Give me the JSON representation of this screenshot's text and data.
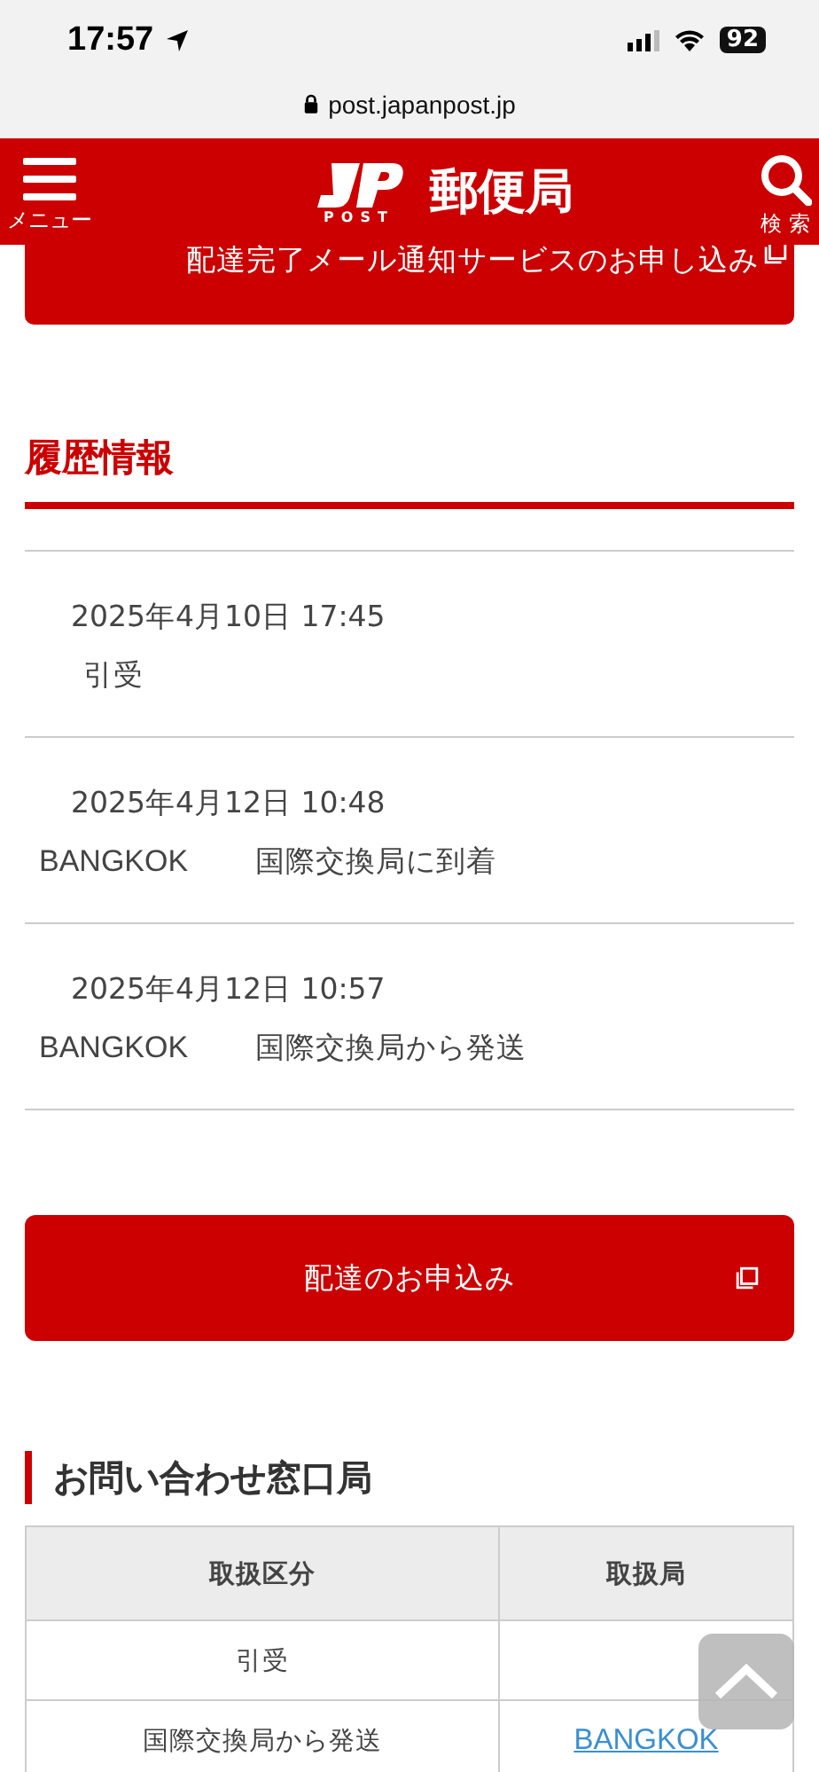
{
  "status_bar": {
    "time": "17:57",
    "battery": "92"
  },
  "browser": {
    "url": "post.japanpost.jp"
  },
  "header": {
    "menu_label": "メニュー",
    "logo_sub": "POST",
    "site_name": "郵便局",
    "search_label": "検 索"
  },
  "notify_button": {
    "label": "配達完了メール通知サービスのお申し込み"
  },
  "history": {
    "title": "履歴情報",
    "entries": [
      {
        "datetime": "2025年4月10日 17:45",
        "description": "引受"
      },
      {
        "datetime": "2025年4月12日 10:48",
        "location": "BANGKOK",
        "description": "国際交換局に到着"
      },
      {
        "datetime": "2025年4月12日 10:57",
        "location": "BANGKOK",
        "description": "国際交換局から発送"
      }
    ]
  },
  "delivery_button": {
    "label": "配達のお申込み"
  },
  "inquiry": {
    "title": "お問い合わせ窓口局",
    "table": {
      "columns": [
        "取扱区分",
        "取扱局"
      ],
      "rows": [
        {
          "category": "引受"
        },
        {
          "category": "国際交換局から発送",
          "office": "BANGKOK"
        }
      ]
    }
  }
}
